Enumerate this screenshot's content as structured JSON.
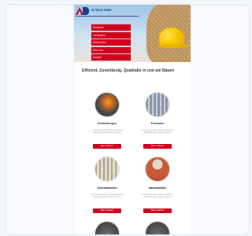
{
  "brand": {
    "name": "ALTHAUS GMBH",
    "accent_color": "#d0021b",
    "secondary_color": "#1b3f8f"
  },
  "menu": {
    "items": [
      "Startseite",
      "Leistungen",
      "Referenzen",
      "Über uns",
      "Kontakt"
    ]
  },
  "intro": {
    "text": "Effizient, Zuverlässig, Qualitativ in und am Bauen"
  },
  "services": [
    {
      "title": "Abdichtungen",
      "text": "Lorem ipsum dolor sit amet consetetur sadipscing elitr sed diam nonumy",
      "button": "Mehr erfahren"
    },
    {
      "title": "Fassaden",
      "text": "Lorem ipsum dolor sit amet consetetur sadipscing elitr sed diam nonumy",
      "button": "Mehr erfahren"
    },
    {
      "title": "Gerüstarbeiten",
      "text": "Lorem ipsum dolor sit amet consetetur sadipscing elitr sed diam nonumy",
      "button": "Mehr erfahren"
    },
    {
      "title": "Dacharbeiten",
      "text": "Lorem ipsum dolor sit amet consetetur sadipscing elitr sed diam nonumy",
      "button": "Mehr erfahren"
    }
  ]
}
